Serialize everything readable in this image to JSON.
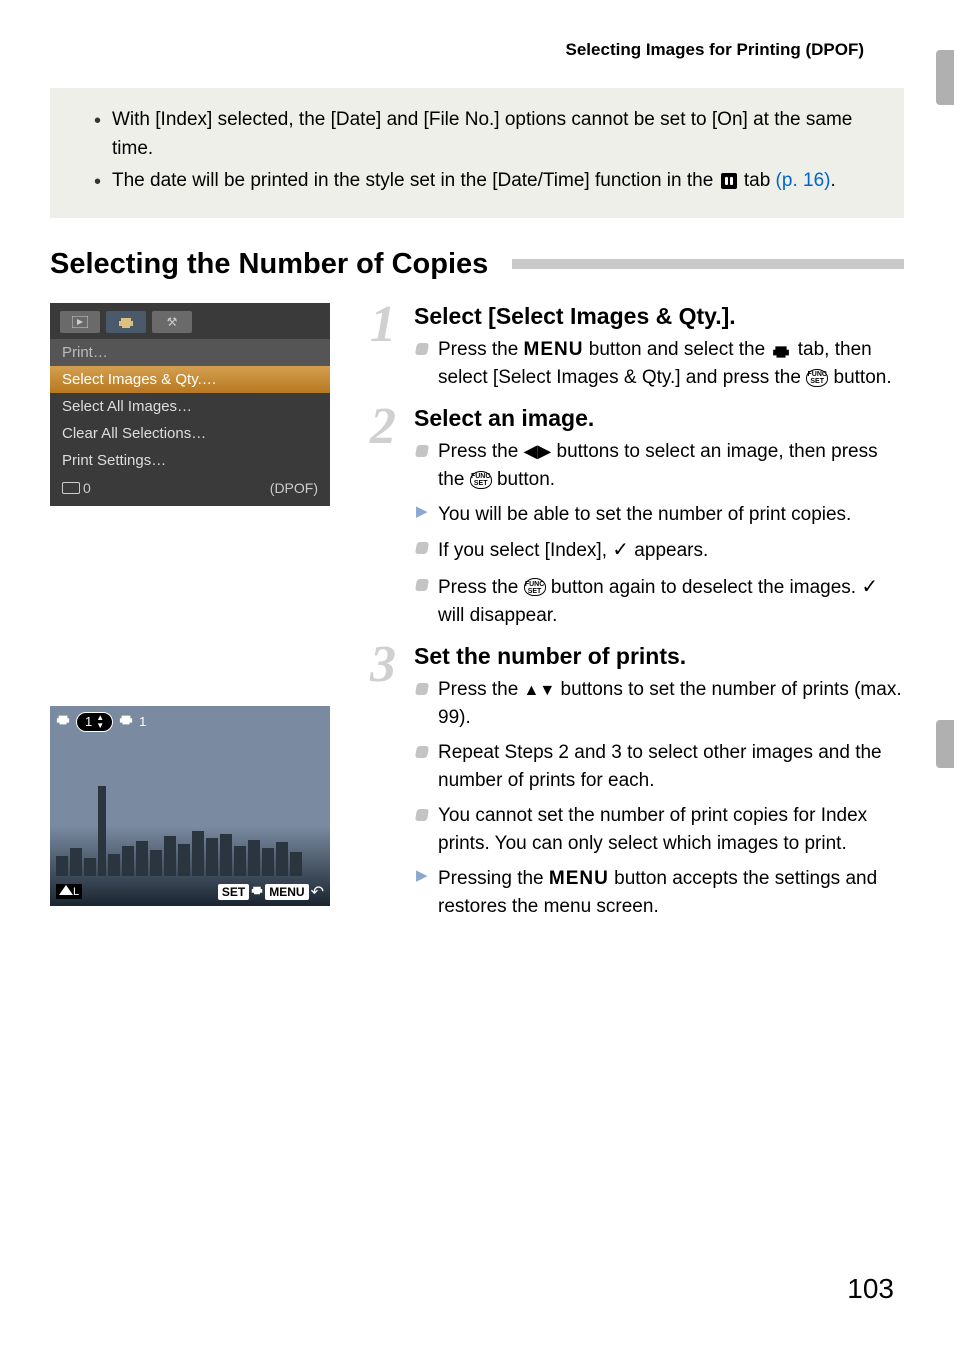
{
  "header": {
    "title": "Selecting Images for Printing (DPOF)"
  },
  "notes": {
    "items": [
      {
        "text_a": "With [Index] selected, the [Date] and [File No.] options cannot be set to [On] at the same time."
      },
      {
        "text_a": "The date will be printed in the style set in the [Date/Time] function in the ",
        "link": "(p. 16)",
        "text_b": " tab ",
        "text_c": "."
      }
    ]
  },
  "section_heading": "Selecting the Number of Copies",
  "menu_screen": {
    "items": [
      "Print…",
      "Select Images & Qty.…",
      "Select All Images…",
      "Clear All Selections…",
      "Print Settings…"
    ],
    "footer_left_count": "0",
    "footer_right": "(DPOF)"
  },
  "screenshot2": {
    "top_count": "1",
    "top_right": "1",
    "bottom_left": "",
    "set_label": "SET",
    "menu_label": "MENU"
  },
  "steps": [
    {
      "num": "1",
      "title": "Select [Select Images & Qty.].",
      "bullets": [
        {
          "kind": "grey",
          "pre": "Press the ",
          "mid": " button and select the ",
          "post": " tab, then select [Select Images & Qty.] and press the ",
          "tail": " button."
        }
      ]
    },
    {
      "num": "2",
      "title": "Select an image.",
      "bullets": [
        {
          "kind": "grey",
          "pre": "Press the ",
          "mid": " buttons to select an image, then press the ",
          "post": " button."
        },
        {
          "kind": "blue",
          "text": "You will be able to set the number of print copies."
        },
        {
          "kind": "grey",
          "pre": "If you select [Index], ",
          "post": " appears."
        },
        {
          "kind": "grey",
          "pre": "Press the ",
          "mid": " button again to deselect the images. ",
          "post": " will disappear."
        }
      ]
    },
    {
      "num": "3",
      "title": "Set the number of prints.",
      "bullets": [
        {
          "kind": "grey",
          "pre": "Press the ",
          "mid": " buttons to set the number of prints (max. 99)."
        },
        {
          "kind": "grey",
          "text": "Repeat Steps 2 and 3 to select other images and the number of prints for each."
        },
        {
          "kind": "grey",
          "text": "You cannot set the number of print copies for Index prints. You can only select which images to print."
        },
        {
          "kind": "blue",
          "pre": "Pressing the ",
          "post": " button accepts the settings and restores the menu screen."
        }
      ]
    }
  ],
  "page_number": "103"
}
